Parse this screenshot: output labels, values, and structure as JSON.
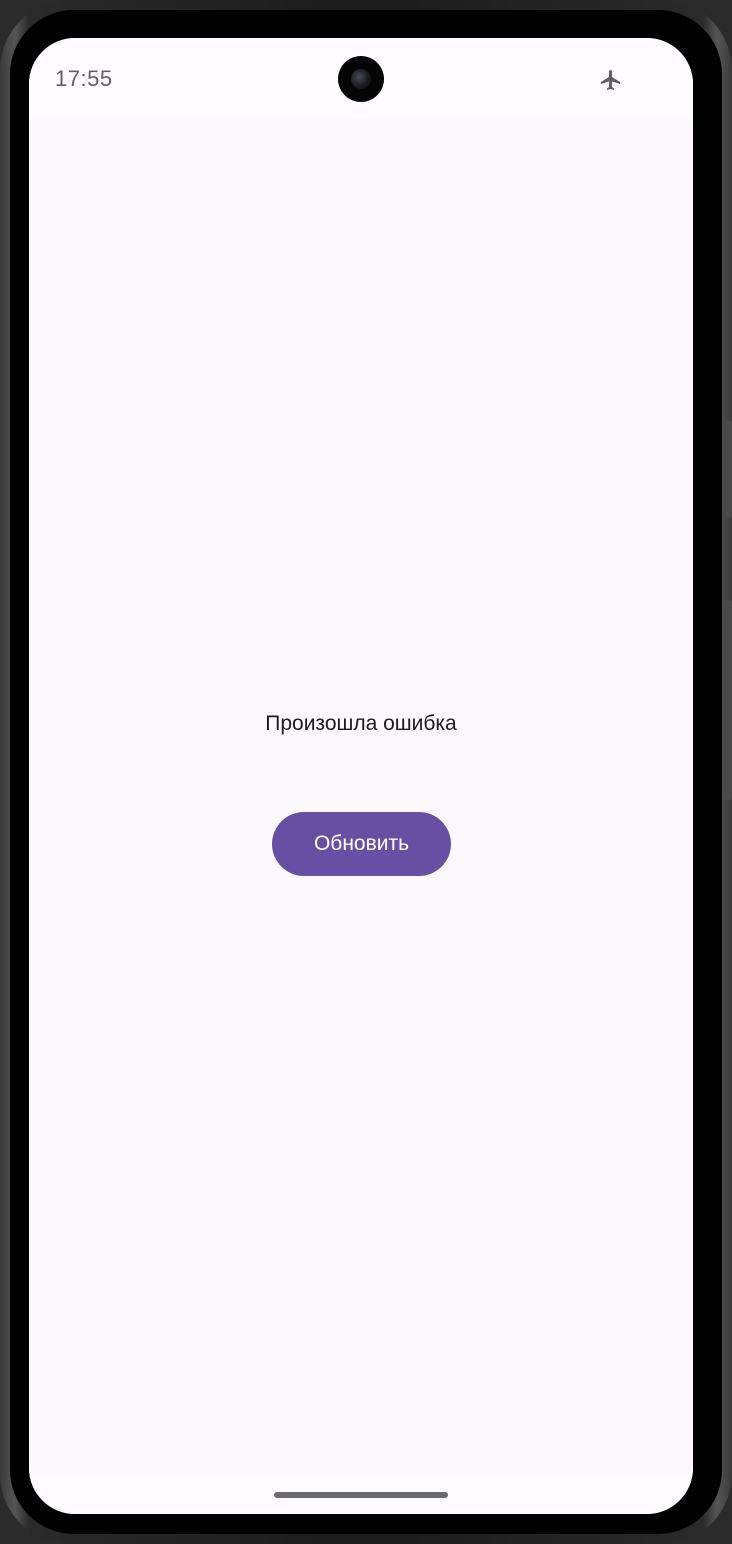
{
  "status_bar": {
    "time": "17:55",
    "icons": [
      "airplane-mode-icon"
    ]
  },
  "main": {
    "error_message": "Произошла ошибка",
    "refresh_button_label": "Обновить"
  },
  "colors": {
    "accent": "#6750a4",
    "background": "#fcf8fd",
    "text": "#1c1b1f"
  }
}
